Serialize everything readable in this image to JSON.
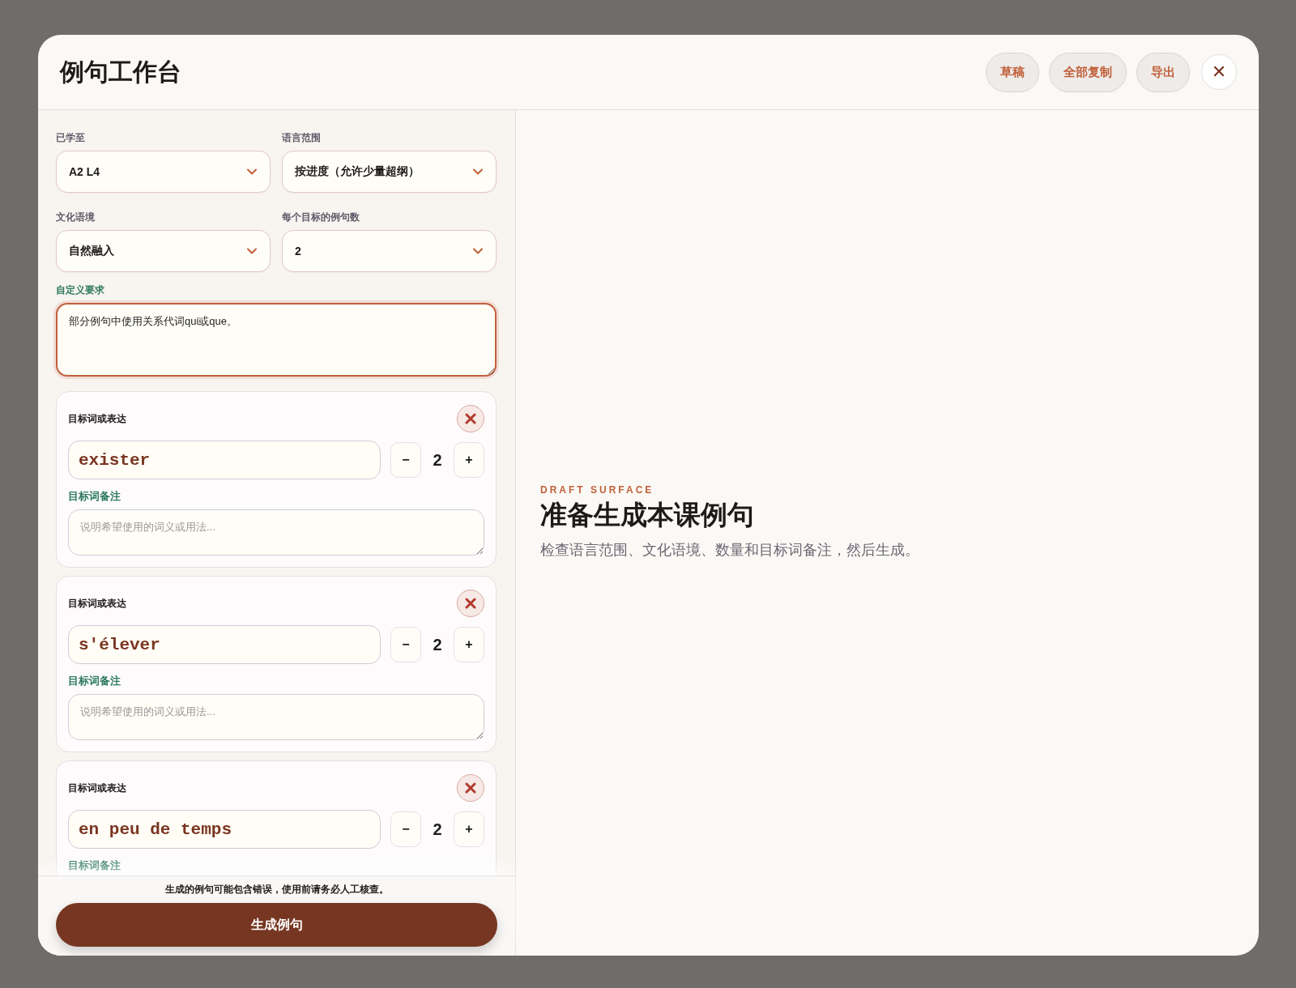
{
  "window": {
    "title": "例句工作台"
  },
  "header_buttons": [
    {
      "kind": "pill",
      "label": "草稿"
    },
    {
      "kind": "pill",
      "label": "全部复制"
    },
    {
      "kind": "pill",
      "label": "导出"
    },
    {
      "kind": "close",
      "label": "✕"
    }
  ],
  "settings": [
    {
      "label": "已学至",
      "value": "A2 L4"
    },
    {
      "label": "语言范围",
      "value": "按进度（允许少量超纲）"
    },
    {
      "label": "文化语境",
      "value": "自然融入"
    },
    {
      "label": "每个目标的例句数",
      "value": "2"
    }
  ],
  "custom_requirement": {
    "label": "自定义要求",
    "value": "部分例句中使用关系代词qui或que。",
    "focused": true
  },
  "targets": [
    {
      "label": "目标词或表达",
      "term": "exister",
      "count": "2",
      "minus": "−",
      "plus": "+",
      "note_label": "目标词备注",
      "note_placeholder": "说明希望使用的词义或用法..."
    },
    {
      "label": "目标词或表达",
      "term": "s'élever",
      "count": "2",
      "minus": "−",
      "plus": "+",
      "note_label": "目标词备注",
      "note_placeholder": "说明希望使用的词义或用法..."
    },
    {
      "label": "目标词或表达",
      "term": "en peu de temps",
      "count": "2",
      "minus": "−",
      "plus": "+",
      "note_label": "目标词备注"
    }
  ],
  "footer": {
    "warning": "生成的例句可能包含错误，使用前请务必人工核查。",
    "button": "生成例句"
  },
  "preview": {
    "eyebrow": "DRAFT SURFACE",
    "heading": "准备生成本课例句",
    "description": "检查语言范围、文化语境、数量和目标词备注，然后生成。"
  }
}
